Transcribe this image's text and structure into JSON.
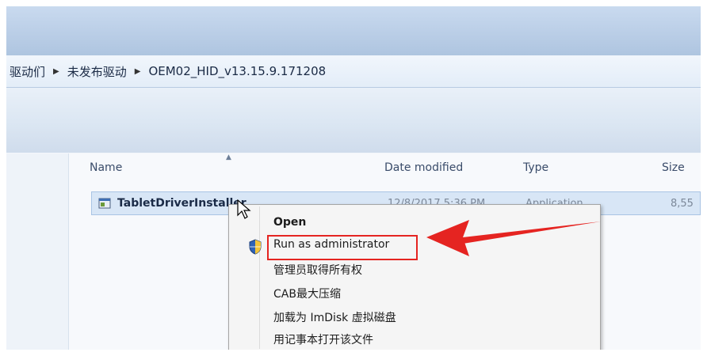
{
  "breadcrumb": {
    "items": [
      "驱动们",
      "未发布驱动",
      "OEM02_HID_v13.15.9.171208"
    ]
  },
  "columns": {
    "name": "Name",
    "date_modified": "Date modified",
    "type": "Type",
    "size": "Size"
  },
  "file_row": {
    "name": "TabletDriverInstaller",
    "date_modified": "12/8/2017 5:36 PM",
    "type": "Application",
    "size": "8,55"
  },
  "context_menu": {
    "items": [
      "Open",
      "Run as administrator",
      "管理员取得所有权",
      "CAB最大压缩",
      "加载为 ImDisk 虚拟磁盘",
      "用记事本打开该文件"
    ]
  },
  "icons": {
    "file": "application-icon",
    "shield": "uac-shield-icon",
    "cursor": "mouse-pointer-icon",
    "breadcrumb_separator": "chevron-right-icon"
  },
  "colors": {
    "annotation_red": "#e52421",
    "selection_blue": "#d8e6f6",
    "menu_background": "#f5f5f5"
  }
}
